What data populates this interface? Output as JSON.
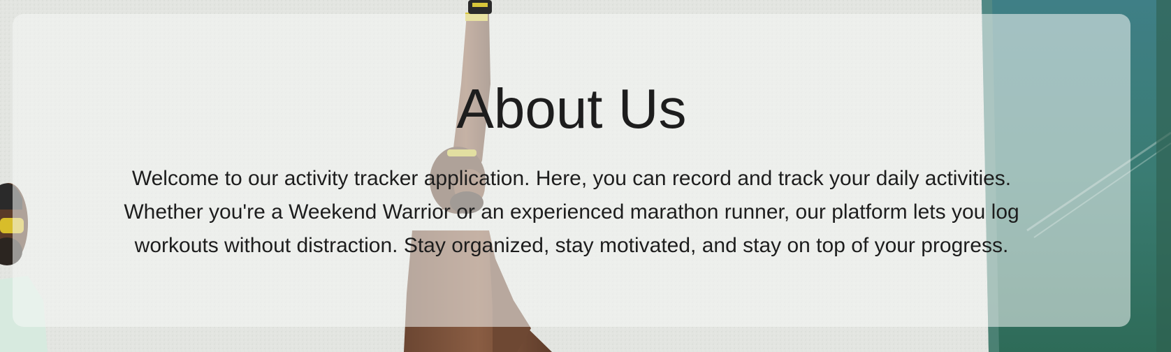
{
  "about": {
    "title": "About Us",
    "description": "Welcome to our activity tracker application. Here, you can record and track your daily activities. Whether you're a Weekend Warrior or an experienced marathon runner, our platform lets you log workouts without distraction. Stay organized, stay motivated, and stay on top of your progress."
  },
  "background": {
    "subject": "athlete reaching up against textured wall",
    "colors": {
      "wall": "#e4e6e2",
      "glass_panel": "#2f6f63",
      "card_overlay": "#f5f7f6",
      "text": "#1d1d1d"
    }
  }
}
